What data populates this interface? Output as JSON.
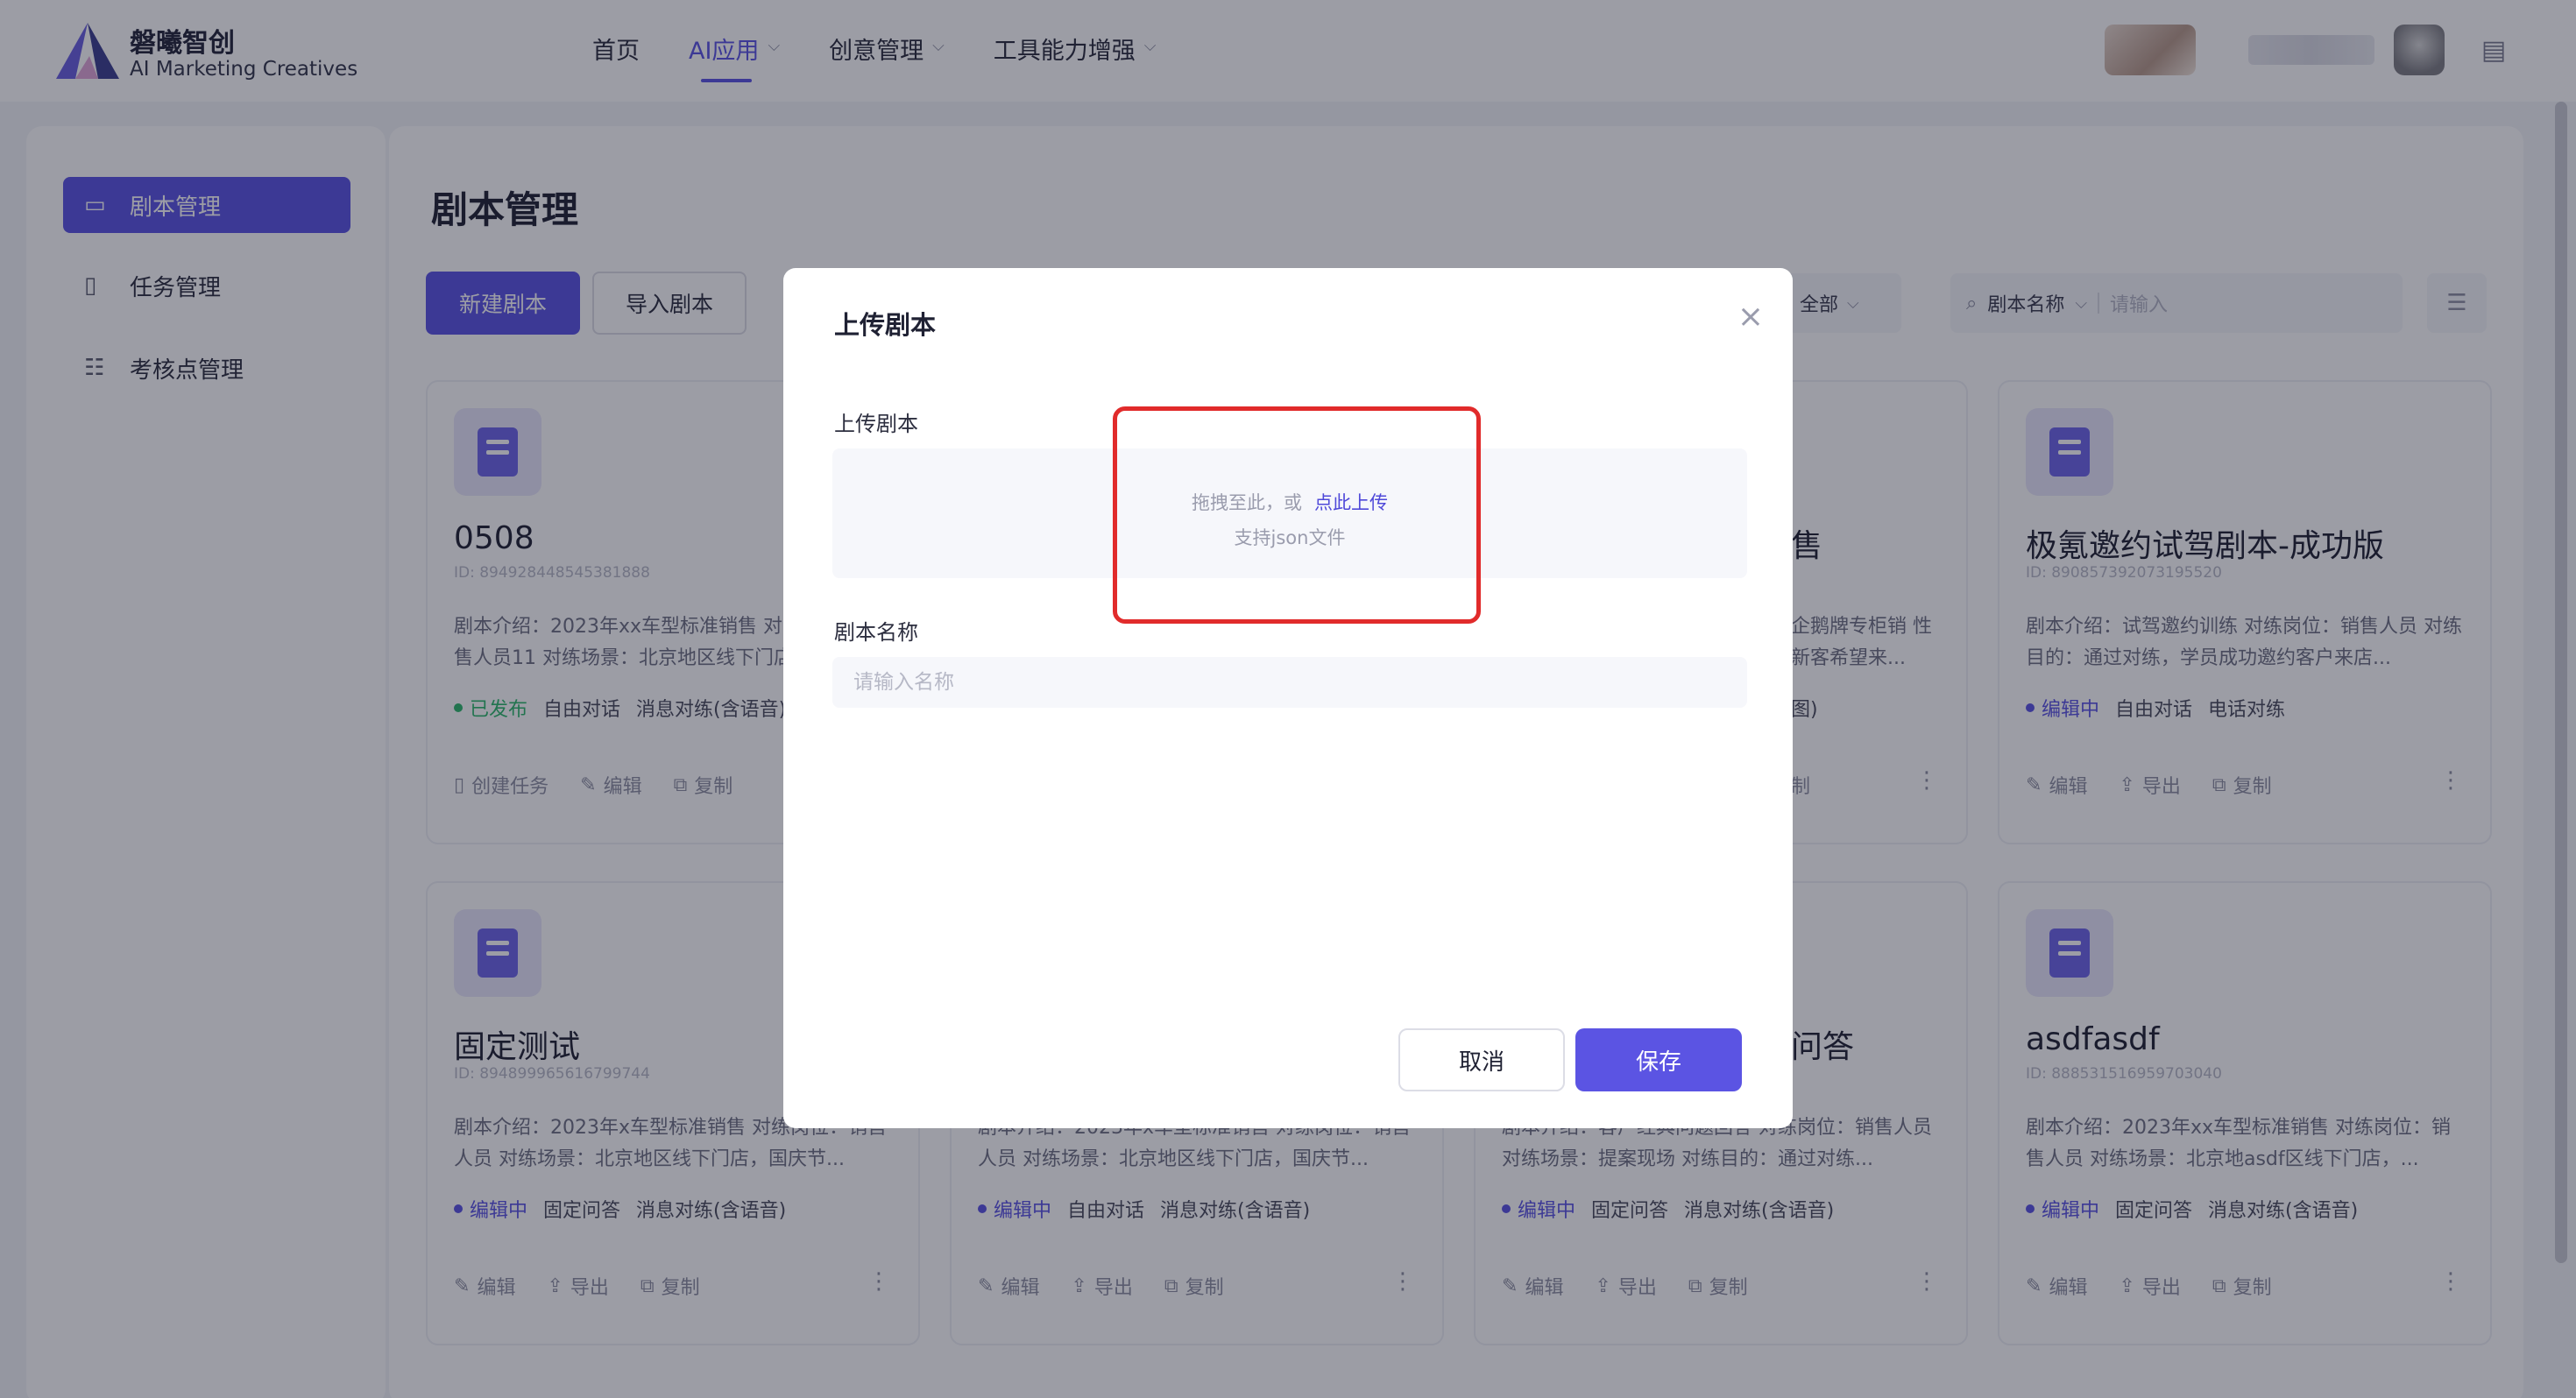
{
  "brand": {
    "name_cn": "磐曦智创",
    "name_en": "AI Marketing Creatives"
  },
  "nav": {
    "items": [
      {
        "label": "首页",
        "has_dropdown": false,
        "active": false
      },
      {
        "label": "AI应用",
        "has_dropdown": true,
        "active": true
      },
      {
        "label": "创意管理",
        "has_dropdown": true,
        "active": false
      },
      {
        "label": "工具能力增强",
        "has_dropdown": true,
        "active": false
      }
    ]
  },
  "sidebar": {
    "items": [
      {
        "label": "剧本管理",
        "icon": "book-icon",
        "active": true
      },
      {
        "label": "任务管理",
        "icon": "task-icon",
        "active": false
      },
      {
        "label": "考核点管理",
        "icon": "checklist-icon",
        "active": false
      }
    ]
  },
  "page": {
    "title": "剧本管理",
    "new_button": "新建剧本",
    "import_button": "导入剧本",
    "filter_value": "全部",
    "search_field": "剧本名称",
    "search_placeholder": "请输入"
  },
  "cards": [
    {
      "title": "0508",
      "id": "ID: 894928448545381888",
      "desc": "剧本介绍：2023年xx车型标准销售 对练岗位：销售人员11 对练场景：北京地区线下门店",
      "status": "已发布",
      "status_type": "published",
      "tags": [
        "自由对话",
        "消息对练(含语音)"
      ],
      "actions": [
        "创建任务",
        "编辑",
        "复制"
      ]
    },
    {
      "title": "售",
      "id": "",
      "desc": "企鹅牌专柜销 性新客希望来...",
      "status": "",
      "status_type": "",
      "tags": [
        "图)"
      ],
      "actions": [
        "制"
      ]
    },
    {
      "title": "极氪邀约试驾剧本-成功版",
      "id": "ID: 890857392073195520",
      "desc": "剧本介绍：试驾邀约训练 对练岗位：销售人员 对练目的：通过对练，学员成功邀约客户来店...",
      "status": "编辑中",
      "status_type": "editing",
      "tags": [
        "自由对话",
        "电话对练"
      ],
      "actions": [
        "编辑",
        "导出",
        "复制"
      ]
    },
    {
      "title": "固定测试",
      "id": "ID: 894899965616799744",
      "desc": "剧本介绍：2023年x车型标准销售 对练岗位：销售人员 对练场景：北京地区线下门店，国庆节...",
      "status": "编辑中",
      "status_type": "editing",
      "tags": [
        "固定问答",
        "消息对练(含语音)"
      ],
      "actions": [
        "编辑",
        "导出",
        "复制"
      ]
    },
    {
      "title": "",
      "id": "",
      "desc": "剧本介绍：2023年x车型标准销售 对练岗位：销售人员 对练场景：北京地区线下门店，国庆节...",
      "status": "编辑中",
      "status_type": "editing",
      "tags": [
        "自由对话",
        "消息对练(含语音)"
      ],
      "actions": [
        "编辑",
        "导出",
        "复制"
      ]
    },
    {
      "title": "问答",
      "id": "",
      "desc": "剧本介绍：客户经典问题回答 对练岗位：销售人员 对练场景：提案现场 对练目的：通过对练...",
      "status": "编辑中",
      "status_type": "editing",
      "tags": [
        "固定问答",
        "消息对练(含语音)"
      ],
      "actions": [
        "编辑",
        "导出",
        "复制"
      ]
    },
    {
      "title": "asdfasdf",
      "id": "ID: 888531516959703040",
      "desc": "剧本介绍：2023年xx车型标准销售 对练岗位：销售人员 对练场景：北京地asdf区线下门店，...",
      "status": "编辑中",
      "status_type": "editing",
      "tags": [
        "固定问答",
        "消息对练(含语音)"
      ],
      "actions": [
        "编辑",
        "导出",
        "复制"
      ]
    }
  ],
  "modal": {
    "title": "上传剧本",
    "upload_label": "上传剧本",
    "upload_hint": "拖拽至此，或",
    "upload_link": "点此上传",
    "upload_support": "支持json文件",
    "name_label": "剧本名称",
    "name_placeholder": "请输入名称",
    "cancel": "取消",
    "save": "保存"
  },
  "colors": {
    "accent": "#5b54e3",
    "published": "#2eb86b",
    "highlight": "#e12b2b"
  }
}
